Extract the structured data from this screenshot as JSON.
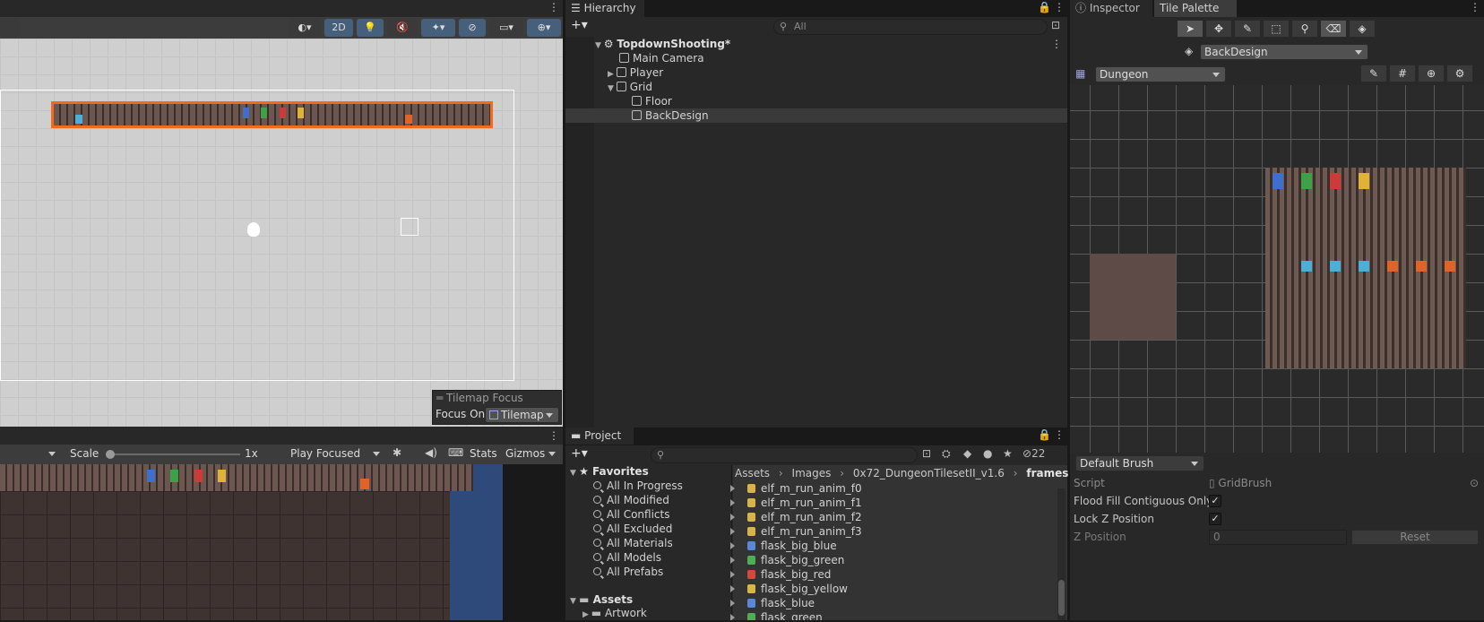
{
  "scene": {
    "mode_2d": "2D",
    "tilemap_focus": {
      "title": "Tilemap Focus",
      "focus_on_label": "Focus On",
      "value": "Tilemap"
    }
  },
  "game": {
    "scale_label": "Scale",
    "scale_value": "1x",
    "play_mode": "Play Focused",
    "stats": "Stats",
    "gizmos": "Gizmos"
  },
  "hierarchy": {
    "tab": "Hierarchy",
    "search_placeholder": "All",
    "items": [
      {
        "label": "TopdownShooting*"
      },
      {
        "label": "Main Camera"
      },
      {
        "label": "Player"
      },
      {
        "label": "Grid"
      },
      {
        "label": "Floor"
      },
      {
        "label": "BackDesign"
      }
    ]
  },
  "project": {
    "tab": "Project",
    "hidden_count": "22",
    "favorites_label": "Favorites",
    "favorites": [
      "All In Progress",
      "All Modified",
      "All Conflicts",
      "All Excluded",
      "All Materials",
      "All Models",
      "All Prefabs"
    ],
    "assets_label": "Assets",
    "assets_children": [
      "Artwork"
    ],
    "breadcrumb": [
      "Assets",
      "Images",
      "0x72_DungeonTilesetII_v1.6",
      "frames"
    ],
    "files": [
      "elf_m_run_anim_f0",
      "elf_m_run_anim_f1",
      "elf_m_run_anim_f2",
      "elf_m_run_anim_f3",
      "flask_big_blue",
      "flask_big_green",
      "flask_big_red",
      "flask_big_yellow",
      "flask_blue",
      "flask_green"
    ],
    "file_colors": [
      "#d8b24a",
      "#d8b24a",
      "#d8b24a",
      "#d8b24a",
      "#5c86d8",
      "#4fae55",
      "#d24a3e",
      "#d8b64a",
      "#5c86d8",
      "#4fae55"
    ]
  },
  "inspector": {
    "tab": "Inspector"
  },
  "palette": {
    "tab": "Tile Palette",
    "active_tilemap": "BackDesign",
    "palette_name": "Dungeon",
    "brush": "Default Brush",
    "script_label": "Script",
    "script_value": "GridBrush",
    "flood_fill_label": "Flood Fill Contiguous Only",
    "flood_fill": true,
    "lock_z_label": "Lock Z Position",
    "lock_z": true,
    "z_position_label": "Z Position",
    "z_position_value": "0",
    "reset_label": "Reset"
  },
  "colors": {
    "selection": "#f26b1d",
    "game_bg": "#2d4a7a",
    "banner_blue": "#3e6fcc",
    "banner_green": "#3fa04a",
    "banner_red": "#cc3a3a",
    "banner_yellow": "#e0b23a"
  }
}
